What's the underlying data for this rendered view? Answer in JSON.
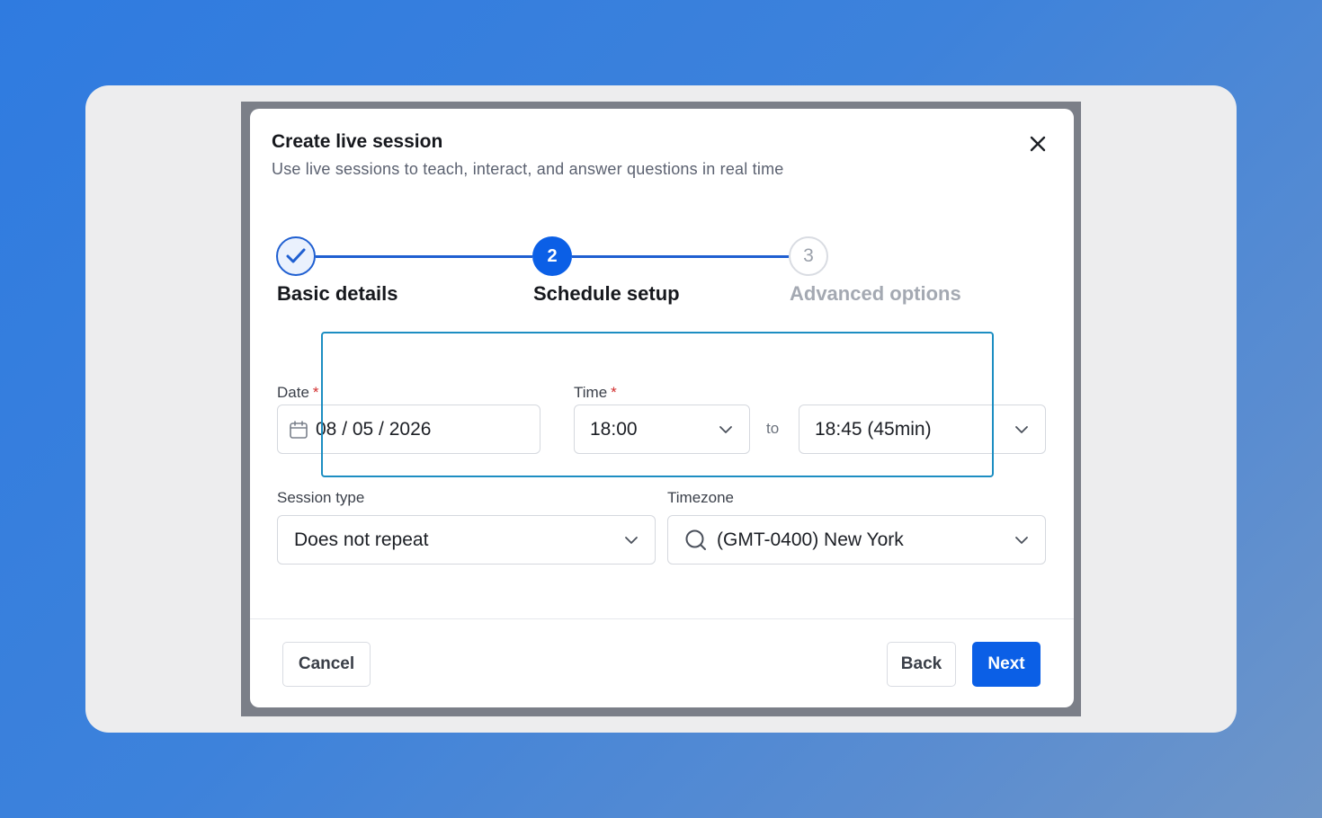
{
  "dialog": {
    "title": "Create live session",
    "subtitle": "Use live sessions to teach, interact, and answer questions in real time"
  },
  "stepper": {
    "steps": [
      {
        "number": "1",
        "label": "Basic details",
        "state": "completed"
      },
      {
        "number": "2",
        "label": "Schedule setup",
        "state": "active"
      },
      {
        "number": "3",
        "label": "Advanced options",
        "state": "upcoming"
      }
    ]
  },
  "form": {
    "date": {
      "label": "Date",
      "required_mark": "*",
      "value": "08 / 05 / 2026"
    },
    "time": {
      "label": "Time",
      "required_mark": "*",
      "start_value": "18:00",
      "separator": "to",
      "end_value": "18:45 (45min)"
    },
    "session_type": {
      "label": "Session type",
      "value": "Does not repeat"
    },
    "timezone": {
      "label": "Timezone",
      "value": "(GMT-0400) New York"
    }
  },
  "footer": {
    "cancel_label": "Cancel",
    "back_label": "Back",
    "next_label": "Next"
  },
  "colors": {
    "primary": "#0b5fe6",
    "highlight_border": "#1d8ec2",
    "required": "#d22f2f"
  }
}
